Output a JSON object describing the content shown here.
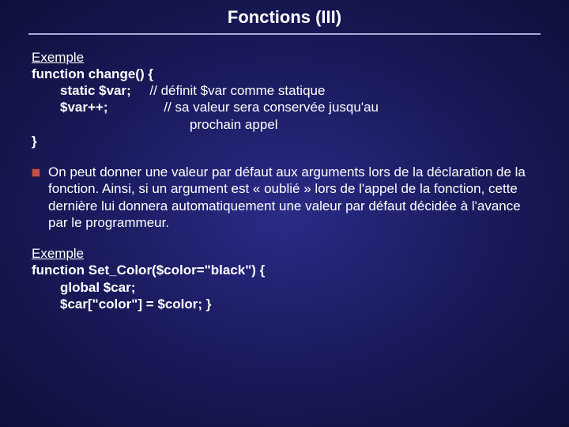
{
  "title": "Fonctions (III)",
  "example_label": "Exemple",
  "ex1": {
    "l1": "function change() {",
    "l2_code": "static $var;",
    "l2_comment": "// définit $var comme statique",
    "l3_code": "$var++;",
    "l3_comment": "// sa valeur sera conservée jusqu'au",
    "l4_comment": "prochain appel",
    "l5": "}"
  },
  "bullet1": "On peut donner une valeur par défaut aux arguments lors de la déclaration de la fonction. Ainsi, si un argument est « oublié » lors de l'appel de la fonction, cette dernière lui donnera automatiquement une valeur par défaut décidée à l'avance par le programmeur.",
  "ex2": {
    "l1_a": "function Set_Color($color",
    "l1_eq": "=",
    "l1_str": "\"black\"",
    "l1_b": ") {",
    "l2": "global $car;",
    "l3": "$car[\"color\"] = $color;   }"
  }
}
